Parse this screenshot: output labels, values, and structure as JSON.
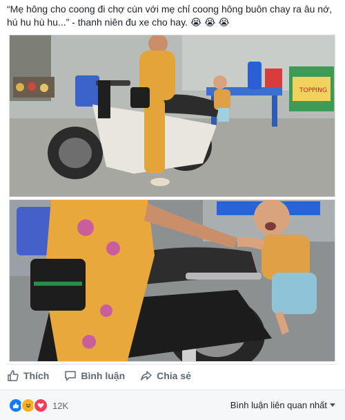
{
  "post": {
    "caption": "“Mẹ hông cho coong đi chợ cùn với mẹ chỉ coong hông buôn chay ra âu nớ, hú hu hù hu...” - thanh niên đu xe cho hay. 😭 😭 😭",
    "photos": [
      {
        "icon": "photo-scooter-street"
      },
      {
        "icon": "photo-child-clinging-seat"
      }
    ]
  },
  "actions": {
    "like_label": "Thích",
    "like_icon": "thumbs-up-icon",
    "comment_label": "Bình luận",
    "comment_icon": "speech-bubble-icon",
    "share_label": "Chia sẻ",
    "share_icon": "share-arrow-icon"
  },
  "footer": {
    "reactions": [
      {
        "icon": "like-reaction-icon",
        "color": "#1877f2"
      },
      {
        "icon": "haha-reaction-icon",
        "color": "#f7b125"
      },
      {
        "icon": "love-reaction-icon",
        "color": "#f33e58"
      }
    ],
    "reaction_count": "12K",
    "sort_label": "Bình luận liên quan nhất"
  }
}
